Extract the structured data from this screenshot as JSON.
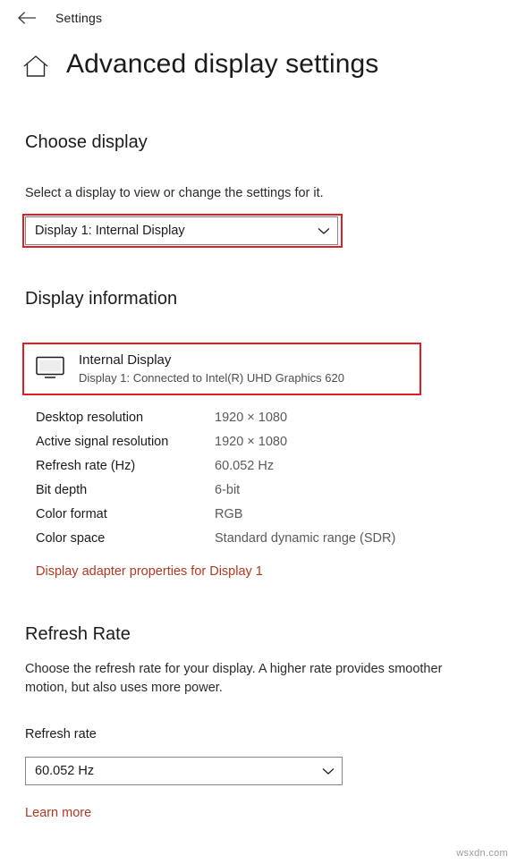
{
  "window": {
    "back_icon": "arrow-left-icon",
    "title": "Settings"
  },
  "page": {
    "home_icon": "home-icon",
    "title": "Advanced display settings",
    "watermark": "wsxdn.com"
  },
  "choose_display": {
    "heading": "Choose display",
    "description": "Select a display to view or change the settings for it.",
    "selected_value": "Display 1: Internal Display",
    "chevron_icon": "chevron-down-icon",
    "options": [
      "Display 1: Internal Display"
    ],
    "highlight_color": "#e02020"
  },
  "display_information": {
    "heading": "Display information",
    "monitor_icon": "monitor-icon",
    "monitor_name": "Internal Display",
    "monitor_sub": "Display 1: Connected to Intel(R) UHD Graphics 620",
    "specs": [
      {
        "key": "Desktop resolution",
        "value": "1920 × 1080"
      },
      {
        "key": "Active signal resolution",
        "value": "1920 × 1080"
      },
      {
        "key": "Refresh rate (Hz)",
        "value": "60.052 Hz"
      },
      {
        "key": "Bit depth",
        "value": "6-bit"
      },
      {
        "key": "Color format",
        "value": "RGB"
      },
      {
        "key": "Color space",
        "value": "Standard dynamic range (SDR)"
      }
    ],
    "adapter_link": "Display adapter properties for Display 1",
    "link_color": "#b4381f"
  },
  "refresh_rate": {
    "heading": "Refresh Rate",
    "description": "Choose the refresh rate for your display. A higher rate provides smoother motion, but also uses more power.",
    "field_label": "Refresh rate",
    "selected_value": "60.052 Hz",
    "chevron_icon": "chevron-down-icon",
    "options": [
      "60.052 Hz"
    ],
    "learn_more": "Learn more"
  }
}
